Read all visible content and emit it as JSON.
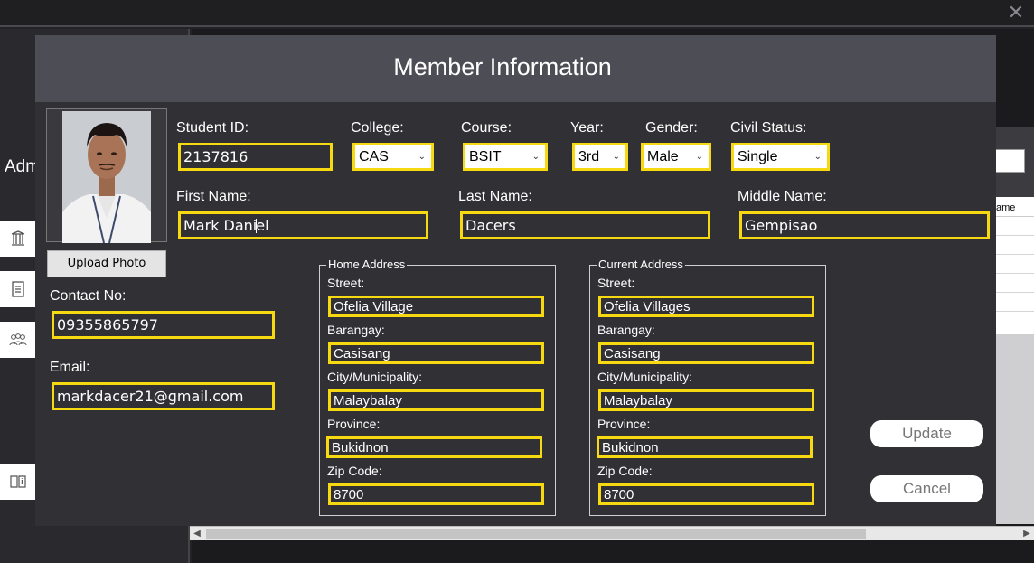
{
  "background": {
    "sidebar_partial_title": "Adm",
    "table_header_partial": "ame"
  },
  "dialog": {
    "title": "Member Information",
    "upload_photo": "Upload Photo",
    "student_id": {
      "label": "Student ID:",
      "value": "2137816"
    },
    "college": {
      "label": "College:",
      "value": "CAS"
    },
    "course": {
      "label": "Course:",
      "value": "BSIT"
    },
    "year": {
      "label": "Year:",
      "value": "3rd"
    },
    "gender": {
      "label": "Gender:",
      "value": "Male"
    },
    "civil_status": {
      "label": "Civil Status:",
      "value": "Single"
    },
    "first_name": {
      "label": "First Name:",
      "value_before_cursor": "Mark Dani",
      "value_after_cursor": "el"
    },
    "last_name": {
      "label": "Last Name:",
      "value": "Dacers"
    },
    "middle_name": {
      "label": "Middle Name:",
      "value": "Gempisao"
    },
    "contact_no": {
      "label": "Contact No:",
      "value": "09355865797"
    },
    "email": {
      "label": "Email:",
      "value": "markdacer21@gmail.com"
    },
    "home_address": {
      "title": "Home Address",
      "street_label": "Street:",
      "street": "Ofelia Village",
      "barangay_label": "Barangay:",
      "barangay": "Casisang",
      "city_label": "City/Municipality:",
      "city": "Malaybalay",
      "province_label": "Province:",
      "province": "Bukidnon",
      "zip_label": "Zip Code:",
      "zip": "8700"
    },
    "current_address": {
      "title": "Current Address",
      "street_label": "Street:",
      "street": "Ofelia Villages",
      "barangay_label": "Barangay:",
      "barangay": "Casisang",
      "city_label": "City/Municipality:",
      "city": "Malaybalay",
      "province_label": "Province:",
      "province": "Bukidnon",
      "zip_label": "Zip Code:",
      "zip": "8700"
    },
    "update_button": "Update",
    "cancel_button": "Cancel"
  },
  "colors": {
    "field_border": "#f6d911",
    "dialog_bg": "#313135",
    "header_bg": "#4d4d55"
  }
}
